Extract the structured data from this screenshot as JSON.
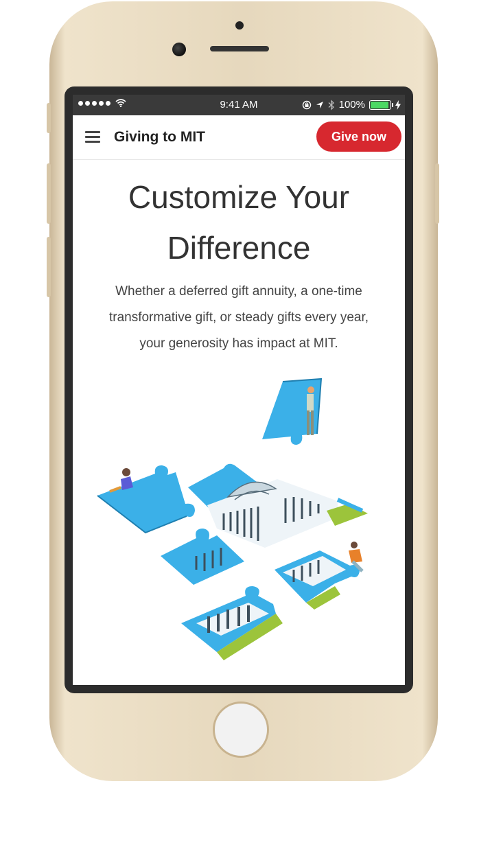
{
  "status_bar": {
    "time": "9:41 AM",
    "battery": "100%",
    "battery_level": 1.0
  },
  "navbar": {
    "menu_icon": "hamburger-menu-icon",
    "title": "Giving to MIT",
    "give_label": "Give now"
  },
  "hero": {
    "headline_line1": "Customize Your",
    "headline_line2": "Difference",
    "body_line1": "Whether a deferred gift annuity, a one-time",
    "body_line2": "transformative gift, or steady gifts every year,",
    "body_line3": "your generosity has impact at MIT."
  },
  "illustration": {
    "icon": "puzzle-pieces-illustration",
    "colors": {
      "piece": "#3bb0e8",
      "grass": "#9cc43b",
      "accent": "#d7282f"
    }
  },
  "device": {
    "home_button_icon": "home-button-icon"
  }
}
